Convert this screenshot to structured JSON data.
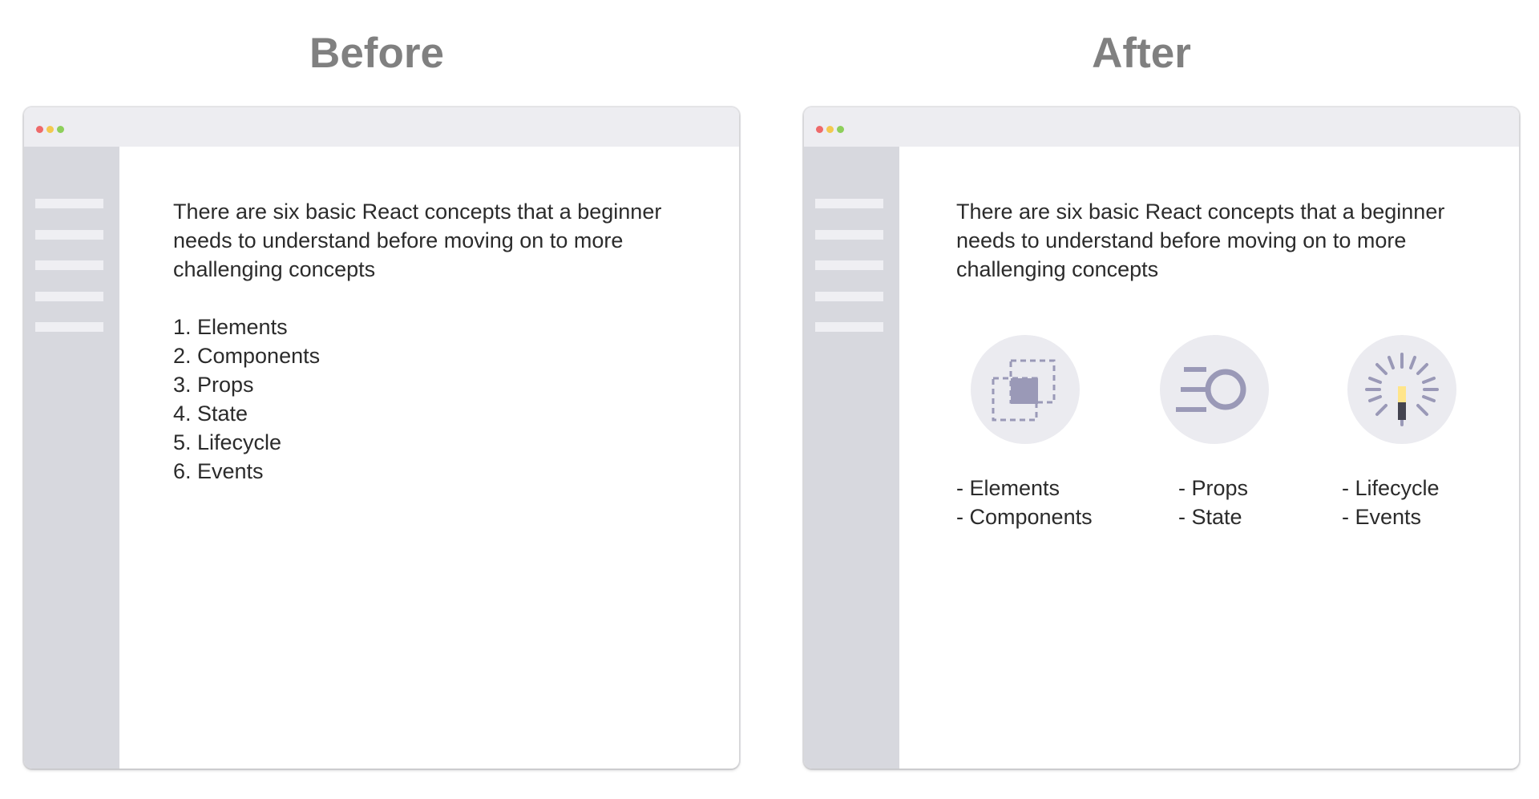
{
  "panels": {
    "before": {
      "title": "Before",
      "intro": "There are six basic React concepts that a beginner needs to understand before moving on to more challenging concepts",
      "list": [
        "1. Elements",
        "2. Components",
        "3. Props",
        "4. State",
        "5. Lifecycle",
        "6. Events"
      ]
    },
    "after": {
      "title": "After",
      "intro": "There are six basic React concepts that a beginner needs to understand before moving on to more challenging concepts",
      "groups": [
        {
          "icon": "overlapping-squares-icon",
          "lines": [
            "- Elements",
            "- Components"
          ]
        },
        {
          "icon": "motion-circle-icon",
          "lines": [
            "- Props",
            "- State"
          ]
        },
        {
          "icon": "magic-wand-sparkle-icon",
          "lines": [
            "- Lifecycle",
            "- Events"
          ]
        }
      ]
    }
  },
  "window_controls": {
    "close": "#ee6a6a",
    "minimize": "#f3c94f",
    "maximize": "#8dcf5b"
  },
  "colors": {
    "title_text": "#808080",
    "sidebar": "#d7d8de",
    "titlebar": "#ededf1",
    "icon_fill": "#9a99b7",
    "icon_circle": "#ebebf0",
    "spark": "#ffe58a"
  }
}
